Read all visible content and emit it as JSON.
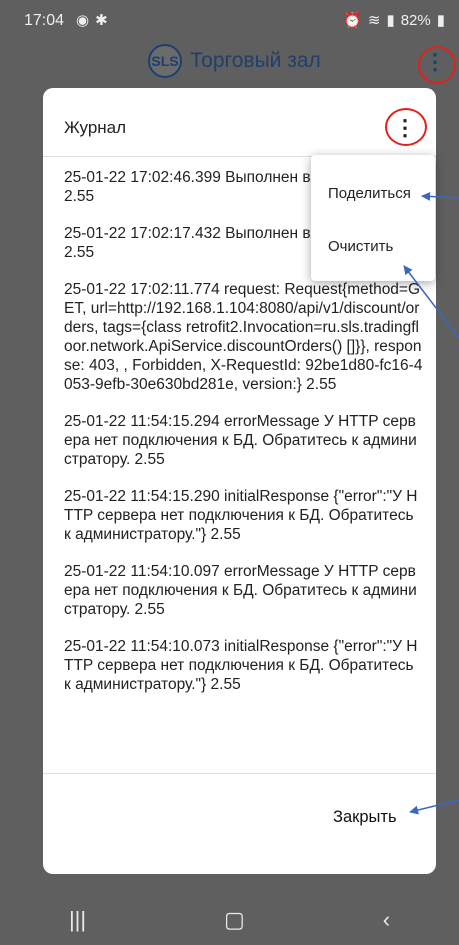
{
  "status_bar": {
    "time": "17:04",
    "battery": "82%",
    "icons": [
      "circle-dot-icon",
      "gear-icon",
      "alarm-icon",
      "wifi-icon",
      "signal-icon",
      "battery-icon"
    ]
  },
  "app_bar": {
    "logo_text": "SLS",
    "title": "Торговый зал"
  },
  "dialog": {
    "title": "Журнал",
    "entries": [
      "25-01-22 17:02:46.399 Выполнен выход - maslova 2.55",
      "25-01-22 17:02:17.432 Выполнен вход - maslova 2.55",
      "25-01-22 17:02:11.774 request: Request{method=GET, url=http://192.168.1.104:8080/api/v1/discount/orders, tags={class retrofit2.Invocation=ru.sls.tradingfloor.network.ApiService.discountOrders() []}}, response: 403, , Forbidden, X-RequestId: 92be1d80-fc16-4053-9efb-30e630bd281e, version:} 2.55",
      "25-01-22 11:54:15.294 errorMessage У HTTP сервера нет подключения к БД. Обратитесь к администратору. 2.55",
      "25-01-22 11:54:15.290 initialResponse {\"error\":\"У HTTP сервера нет подключения к БД. Обратитесь к администратору.\"} 2.55",
      "25-01-22 11:54:10.097 errorMessage У HTTP сервера нет подключения к БД. Обратитесь к администратору. 2.55",
      "25-01-22 11:54:10.073 initialResponse {\"error\":\"У HTTP сервера нет подключения к БД. Обратитесь к администратору.\"} 2.55"
    ],
    "close_label": "Закрыть"
  },
  "popup_menu": {
    "share_label": "Поделиться",
    "clear_label": "Очистить"
  },
  "colors": {
    "accent": "#1c3f73",
    "annotation_red": "#e0221c",
    "annotation_arrow": "#3a66c4"
  }
}
